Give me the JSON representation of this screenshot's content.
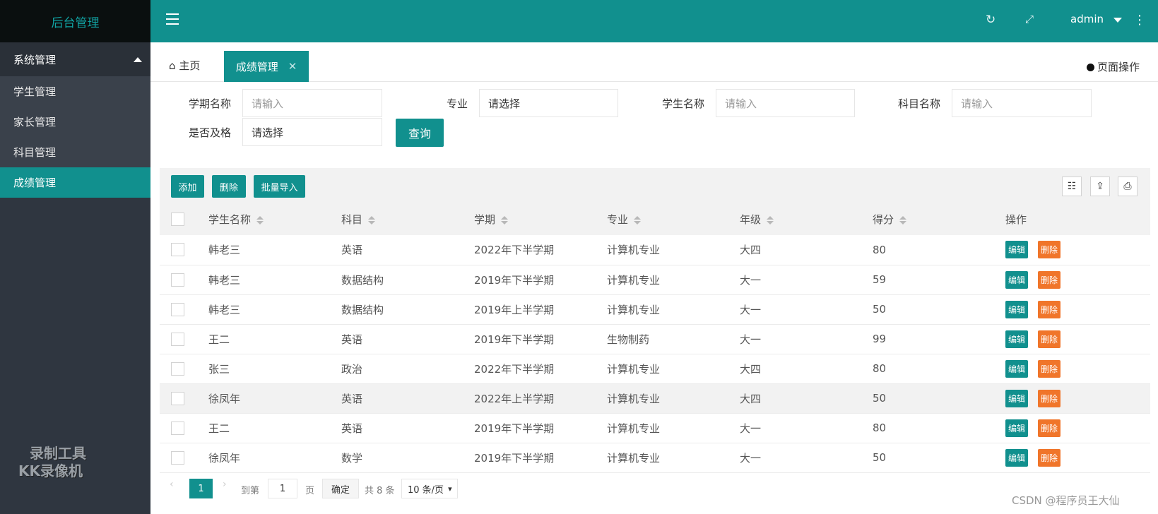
{
  "sidebar": {
    "logo": "后台管理",
    "group": "系统管理",
    "items": [
      {
        "label": "学生管理"
      },
      {
        "label": "家长管理"
      },
      {
        "label": "科目管理"
      },
      {
        "label": "成绩管理"
      }
    ],
    "watermark_line1": "录制工具",
    "watermark_line2": "KK录像机"
  },
  "header": {
    "user": "admin"
  },
  "tabs": {
    "home": "主页",
    "active": "成绩管理",
    "page_ops": "页面操作"
  },
  "search": {
    "term_label": "学期名称",
    "term_placeholder": "请输入",
    "major_label": "专业",
    "major_value": "请选择",
    "student_label": "学生名称",
    "student_placeholder": "请输入",
    "subject_label": "科目名称",
    "subject_placeholder": "请输入",
    "pass_label": "是否及格",
    "pass_value": "请选择",
    "query_button": "查询"
  },
  "toolbar": {
    "add": "添加",
    "delete": "删除",
    "import": "批量导入"
  },
  "table": {
    "columns": [
      "学生名称",
      "科目",
      "学期",
      "专业",
      "年级",
      "得分",
      "操作"
    ],
    "edit_label": "编辑",
    "delete_label": "删除",
    "rows": [
      {
        "name": "韩老三",
        "subject": "英语",
        "term": "2022年下半学期",
        "major": "计算机专业",
        "grade": "大四",
        "score": "80"
      },
      {
        "name": "韩老三",
        "subject": "数据结构",
        "term": "2019年下半学期",
        "major": "计算机专业",
        "grade": "大一",
        "score": "59"
      },
      {
        "name": "韩老三",
        "subject": "数据结构",
        "term": "2019年上半学期",
        "major": "计算机专业",
        "grade": "大一",
        "score": "50"
      },
      {
        "name": "王二",
        "subject": "英语",
        "term": "2019年下半学期",
        "major": "生物制药",
        "grade": "大一",
        "score": "99"
      },
      {
        "name": "张三",
        "subject": "政治",
        "term": "2022年下半学期",
        "major": "计算机专业",
        "grade": "大四",
        "score": "80"
      },
      {
        "name": "徐凤年",
        "subject": "英语",
        "term": "2022年上半学期",
        "major": "计算机专业",
        "grade": "大四",
        "score": "50"
      },
      {
        "name": "王二",
        "subject": "英语",
        "term": "2019年下半学期",
        "major": "计算机专业",
        "grade": "大一",
        "score": "80"
      },
      {
        "name": "徐凤年",
        "subject": "数学",
        "term": "2019年下半学期",
        "major": "计算机专业",
        "grade": "大一",
        "score": "50"
      }
    ]
  },
  "pagination": {
    "current": "1",
    "goto_label": "到第",
    "goto_value": "1",
    "page_label": "页",
    "confirm": "确定",
    "total": "共 8 条",
    "page_size": "10 条/页"
  },
  "credit": "CSDN @程序员王大仙"
}
